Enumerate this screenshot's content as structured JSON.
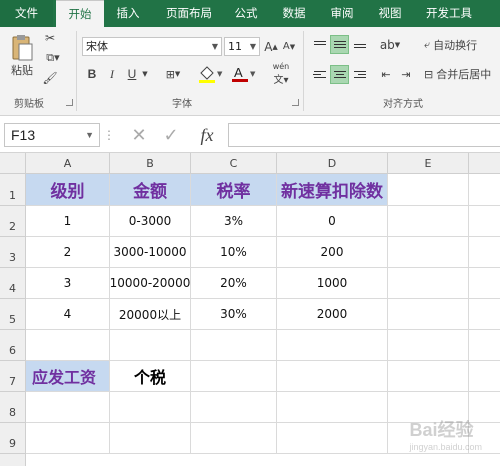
{
  "tabs": [
    "文件",
    "开始",
    "插入",
    "页面布局",
    "公式",
    "数据",
    "审阅",
    "视图",
    "开发工具"
  ],
  "ribbon": {
    "clipboard": {
      "paste_label": "粘贴",
      "group_label": "剪贴板"
    },
    "font": {
      "name": "宋体",
      "size": "11",
      "bold": "B",
      "italic": "I",
      "underline": "U",
      "phonetic": "wén",
      "group_label": "字体"
    },
    "alignment": {
      "wrap_text": "自动换行",
      "merge_center": "合并后居中",
      "group_label": "对齐方式"
    }
  },
  "formula_bar": {
    "cell_ref": "F13",
    "fx": "fx",
    "value": ""
  },
  "sheet": {
    "columns": [
      "A",
      "B",
      "C",
      "D",
      "E"
    ],
    "rows": [
      "1",
      "2",
      "3",
      "4",
      "5",
      "6",
      "7",
      "8",
      "9"
    ],
    "header_row": [
      "级别",
      "金额",
      "税率",
      "新速算扣除数"
    ],
    "data_rows": [
      [
        "1",
        "0-3000",
        "3%",
        "0"
      ],
      [
        "2",
        "3000-10000",
        "10%",
        "200"
      ],
      [
        "3",
        "10000-20000",
        "20%",
        "1000"
      ],
      [
        "4",
        "20000以上",
        "30%",
        "2000"
      ]
    ],
    "a7": "应发工资",
    "b7": "个税"
  },
  "watermark": {
    "text": "Bai经验",
    "sub": "jingyan.baidu.com"
  },
  "colors": {
    "excel_green": "#217346",
    "header_fill": "#c6d9f0",
    "header_text": "#7030a0"
  }
}
